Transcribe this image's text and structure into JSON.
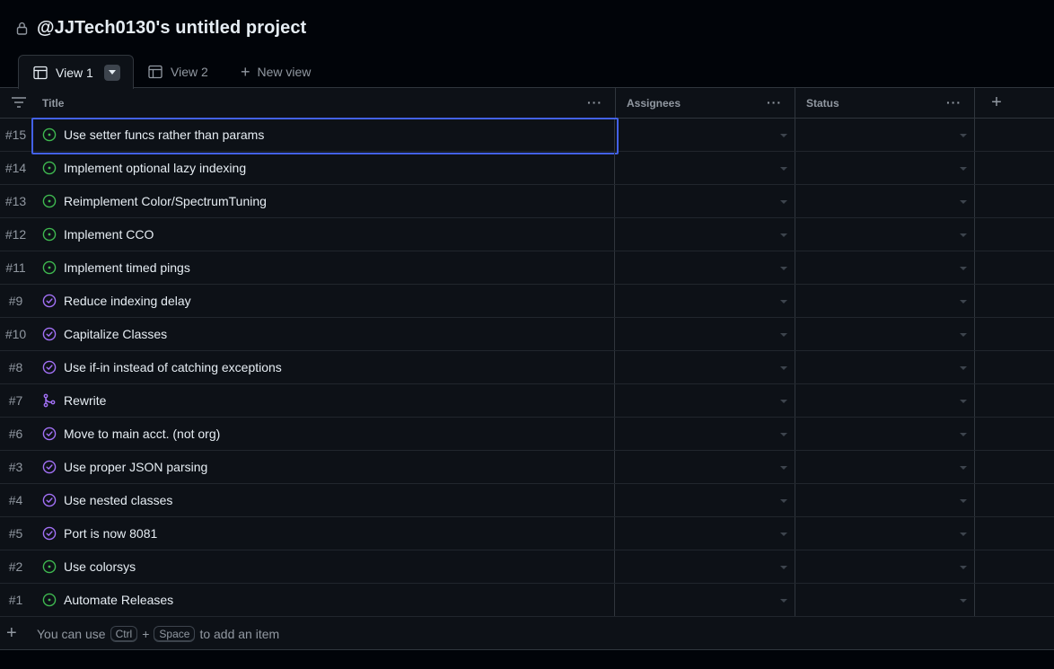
{
  "project": {
    "title": "@JJTech0130's untitled project"
  },
  "tabs": [
    {
      "label": "View 1",
      "active": true
    },
    {
      "label": "View 2",
      "active": false
    },
    {
      "label": "New view",
      "active": false
    }
  ],
  "columns": {
    "title": "Title",
    "assignees": "Assignees",
    "status": "Status"
  },
  "menu_glyph": "···",
  "rows": [
    {
      "num": "#15",
      "title": "Use setter funcs rather than params",
      "state": "open"
    },
    {
      "num": "#14",
      "title": "Implement optional lazy indexing",
      "state": "open"
    },
    {
      "num": "#13",
      "title": "Reimplement Color/SpectrumTuning",
      "state": "open"
    },
    {
      "num": "#12",
      "title": "Implement CCO",
      "state": "open"
    },
    {
      "num": "#11",
      "title": "Implement timed pings",
      "state": "open"
    },
    {
      "num": "#9",
      "title": "Reduce indexing delay",
      "state": "closed"
    },
    {
      "num": "#10",
      "title": "Capitalize Classes",
      "state": "closed"
    },
    {
      "num": "#8",
      "title": "Use if-in instead of catching exceptions",
      "state": "closed"
    },
    {
      "num": "#7",
      "title": "Rewrite",
      "state": "merged"
    },
    {
      "num": "#6",
      "title": "Move to main acct. (not org)",
      "state": "closed"
    },
    {
      "num": "#3",
      "title": "Use proper JSON parsing",
      "state": "closed"
    },
    {
      "num": "#4",
      "title": "Use nested classes",
      "state": "closed"
    },
    {
      "num": "#5",
      "title": "Port is now 8081",
      "state": "closed"
    },
    {
      "num": "#2",
      "title": "Use colorsys",
      "state": "open"
    },
    {
      "num": "#1",
      "title": "Automate Releases",
      "state": "open"
    }
  ],
  "footer": {
    "prefix": "You can use",
    "key1": "Ctrl",
    "plus": "+",
    "key2": "Space",
    "suffix": "to add an item"
  },
  "colors": {
    "open": "#3fb950",
    "closed": "#a371f7",
    "merged": "#a371f7",
    "selection": "#4361e6"
  }
}
